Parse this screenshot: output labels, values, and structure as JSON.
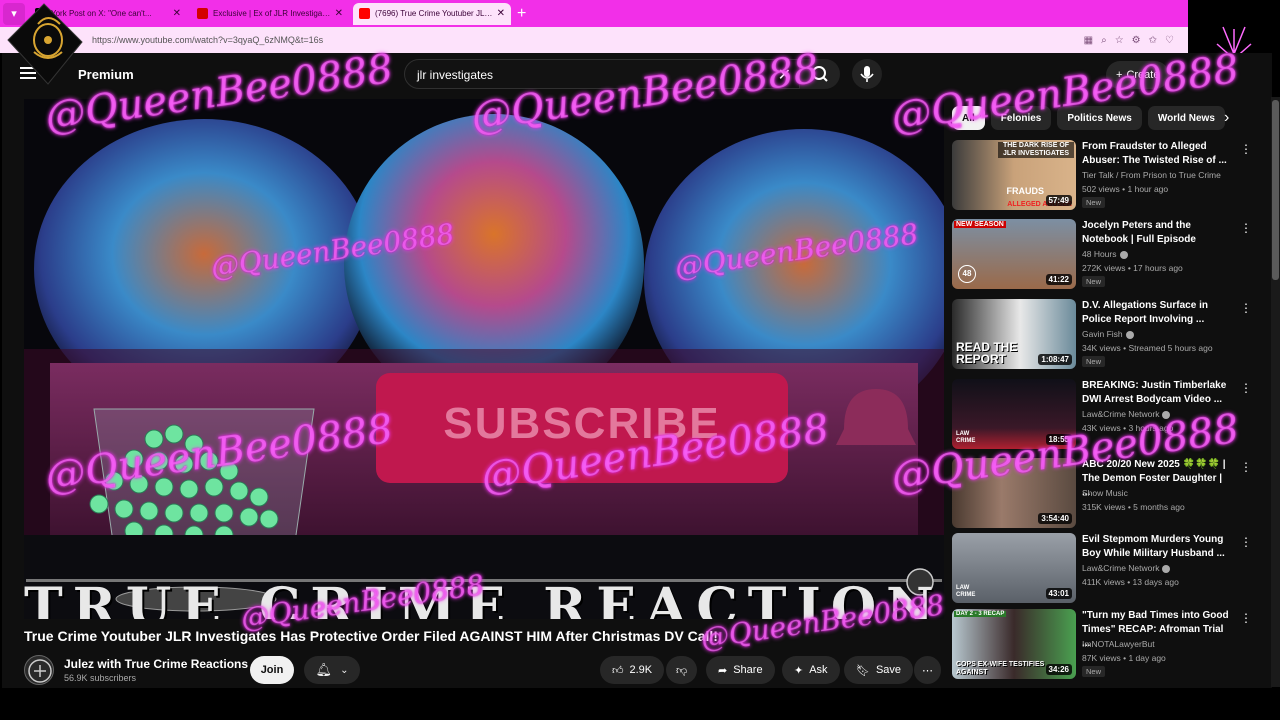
{
  "browser": {
    "tabs": [
      {
        "title": "York Post on X: \"One can't...",
        "favicon": "x-logo",
        "active": false
      },
      {
        "title": "Exclusive | Ex of JLR Investigates al...",
        "favicon": "nypost",
        "active": false
      },
      {
        "title": "(7696) True Crime Youtuber JLR Inv...",
        "favicon": "youtube",
        "active": true
      }
    ],
    "url": "https://www.youtube.com/watch?v=3qyaQ_6zNMQ&t=16s"
  },
  "header": {
    "brand": "Premium",
    "search_value": "jlr investigates",
    "create_label": "Create"
  },
  "video": {
    "title": "True Crime Youtuber JLR Investigates Has Protective Order Filed AGAINST HIM After Christmas DV Call!",
    "overlay_subscribe": "SUBSCRIBE",
    "overlay_banner": "TRUE CRIME REACTIONS",
    "channel": "Julez with True Crime Reactions",
    "subscribers": "56.9K subscribers",
    "join_label": "Join",
    "likes": "2.9K",
    "share_label": "Share",
    "ask_label": "Ask",
    "save_label": "Save"
  },
  "chips": [
    "All",
    "Felonies",
    "Politics News",
    "World News"
  ],
  "recommendations": [
    {
      "title": "From Fraudster to Alleged Abuser: The Twisted Rise of ...",
      "channel": "Tier Talk / From Prison to True Crime",
      "meta": "502 views • 1 hour ago",
      "badge": "New",
      "duration": "57:49",
      "thumb_text": "THE DARK RISE OF JLR INVESTIGATES",
      "thumb_text2": "FRAUDS",
      "thumb_text3": "ALLEGED ABUSER",
      "verified": false
    },
    {
      "title": "Jocelyn Peters and the Notebook | Full Episode",
      "channel": "48 Hours",
      "meta": "272K views • 17 hours ago",
      "badge": "New",
      "duration": "41:22",
      "thumb_text": "NEW SEASON",
      "thumb_text2": "48",
      "verified": true
    },
    {
      "title": "D.V. Allegations Surface in Police Report Involving ...",
      "channel": "Gavin Fish",
      "meta": "34K views • Streamed 5 hours ago",
      "badge": "New",
      "duration": "1:08:47",
      "thumb_text": "READ THE REPORT",
      "verified": true
    },
    {
      "title": "BREAKING: Justin Timberlake DWI Arrest Bodycam Video ...",
      "channel": "Law&Crime Network",
      "meta": "43K views • 3 hours ago",
      "badge": "",
      "duration": "18:55",
      "thumb_text": "LAW CRIME",
      "verified": true
    },
    {
      "title": "ABC 20/20 New 2025 🍀🍀🍀 | The Demon Foster Daughter | ...",
      "channel": "Show Music",
      "meta": "315K views • 5 months ago",
      "badge": "",
      "duration": "3:54:40",
      "verified": false
    },
    {
      "title": "Evil Stepmom Murders Young Boy While Military Husband ...",
      "channel": "Law&Crime Network",
      "meta": "411K views • 13 days ago",
      "badge": "",
      "duration": "43:01",
      "thumb_text": "LAW CRIME",
      "verified": true
    },
    {
      "title": "\"Turn my Bad Times into Good Times\" RECAP: Afroman Trial ...",
      "channel": "ImNOTALawyerBut",
      "meta": "87K views • 1 day ago",
      "badge": "New",
      "duration": "34:26",
      "thumb_text": "DAY 2 - 3 RECAP",
      "thumb_text2": "COPS EX-WIFE TESTIFIES AGAINST",
      "verified": false
    }
  ],
  "watermark": "@QueenBee0888",
  "colors": {
    "browser_accent": "#f22fe8",
    "watermark": "#ff82ff",
    "page_bg": "#0f0f0f"
  }
}
